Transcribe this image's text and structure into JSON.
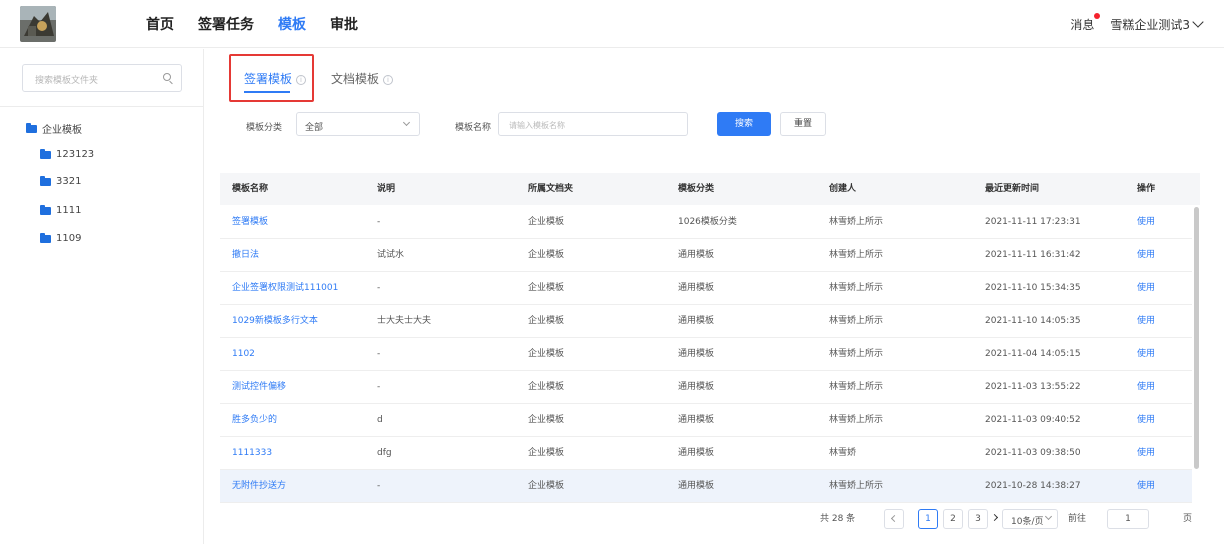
{
  "header": {
    "nav": [
      "首页",
      "签署任务",
      "模板",
      "审批"
    ],
    "active_nav_index": 2,
    "message_label": "消息",
    "user_name": "雪糕企业测试3",
    "accent_color": "#2f7bf5"
  },
  "sidebar": {
    "search_placeholder": "搜索模板文件夹",
    "root_folder": "企业模板",
    "folders": [
      "123123",
      "3321",
      "1111",
      "1109"
    ]
  },
  "tabs": [
    {
      "label": "签署模板",
      "active": true,
      "info_icon": "i"
    },
    {
      "label": "文档模板",
      "active": false,
      "info_icon": "i"
    }
  ],
  "filters": {
    "category_label": "模板分类",
    "category_value": "全部",
    "name_label": "模板名称",
    "name_placeholder": "请输入模板名称",
    "search_button": "搜索",
    "reset_button": "重置"
  },
  "table": {
    "headers": [
      "模板名称",
      "说明",
      "所属文档夹",
      "模板分类",
      "创建人",
      "最近更新时间",
      "操作"
    ],
    "rows": [
      {
        "name": "签署模板",
        "desc": "-",
        "folder": "企业模板",
        "category": "1026模板分类",
        "creator": "林雪娇上所示",
        "updated": "2021-11-11 17:23:31",
        "action": "使用"
      },
      {
        "name": "撤日法",
        "desc": "试试水",
        "folder": "企业模板",
        "category": "通用模板",
        "creator": "林雪娇上所示",
        "updated": "2021-11-11 16:31:42",
        "action": "使用"
      },
      {
        "name": "企业签署权限测试111001",
        "desc": "-",
        "folder": "企业模板",
        "category": "通用模板",
        "creator": "林雪娇上所示",
        "updated": "2021-11-10 15:34:35",
        "action": "使用"
      },
      {
        "name": "1029新模板多行文本",
        "desc": "士大夫士大夫",
        "folder": "企业模板",
        "category": "通用模板",
        "creator": "林雪娇上所示",
        "updated": "2021-11-10 14:05:35",
        "action": "使用"
      },
      {
        "name": "1102",
        "desc": "-",
        "folder": "企业模板",
        "category": "通用模板",
        "creator": "林雪娇上所示",
        "updated": "2021-11-04 14:05:15",
        "action": "使用"
      },
      {
        "name": "测试控件偏移",
        "desc": "-",
        "folder": "企业模板",
        "category": "通用模板",
        "creator": "林雪娇上所示",
        "updated": "2021-11-03 13:55:22",
        "action": "使用"
      },
      {
        "name": "胜多负少的",
        "desc": "d",
        "folder": "企业模板",
        "category": "通用模板",
        "creator": "林雪娇上所示",
        "updated": "2021-11-03 09:40:52",
        "action": "使用"
      },
      {
        "name": "1111333",
        "desc": "dfg",
        "folder": "企业模板",
        "category": "通用模板",
        "creator": "林雪娇",
        "updated": "2021-11-03 09:38:50",
        "action": "使用"
      },
      {
        "name": "无附件抄送方",
        "desc": "-",
        "folder": "企业模板",
        "category": "通用模板",
        "creator": "林雪娇上所示",
        "updated": "2021-10-28 14:38:27",
        "action": "使用"
      }
    ]
  },
  "pagination": {
    "total": "共 28 条",
    "pages": [
      "1",
      "2",
      "3"
    ],
    "current_page": "1",
    "page_size": "10条/页",
    "goto_label": "前往",
    "goto_value": "1",
    "page_suffix": "页"
  }
}
